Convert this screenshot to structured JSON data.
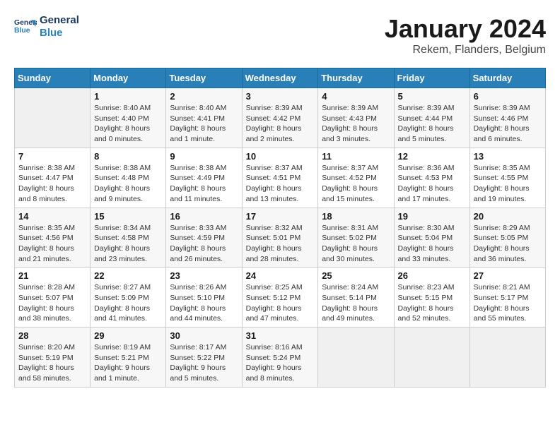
{
  "logo": {
    "text_general": "General",
    "text_blue": "Blue"
  },
  "title": "January 2024",
  "subtitle": "Rekem, Flanders, Belgium",
  "calendar": {
    "headers": [
      "Sunday",
      "Monday",
      "Tuesday",
      "Wednesday",
      "Thursday",
      "Friday",
      "Saturday"
    ],
    "weeks": [
      [
        {
          "day": "",
          "sunrise": "",
          "sunset": "",
          "daylight": ""
        },
        {
          "day": "1",
          "sunrise": "Sunrise: 8:40 AM",
          "sunset": "Sunset: 4:40 PM",
          "daylight": "Daylight: 8 hours and 0 minutes."
        },
        {
          "day": "2",
          "sunrise": "Sunrise: 8:40 AM",
          "sunset": "Sunset: 4:41 PM",
          "daylight": "Daylight: 8 hours and 1 minute."
        },
        {
          "day": "3",
          "sunrise": "Sunrise: 8:39 AM",
          "sunset": "Sunset: 4:42 PM",
          "daylight": "Daylight: 8 hours and 2 minutes."
        },
        {
          "day": "4",
          "sunrise": "Sunrise: 8:39 AM",
          "sunset": "Sunset: 4:43 PM",
          "daylight": "Daylight: 8 hours and 3 minutes."
        },
        {
          "day": "5",
          "sunrise": "Sunrise: 8:39 AM",
          "sunset": "Sunset: 4:44 PM",
          "daylight": "Daylight: 8 hours and 5 minutes."
        },
        {
          "day": "6",
          "sunrise": "Sunrise: 8:39 AM",
          "sunset": "Sunset: 4:46 PM",
          "daylight": "Daylight: 8 hours and 6 minutes."
        }
      ],
      [
        {
          "day": "7",
          "sunrise": "Sunrise: 8:38 AM",
          "sunset": "Sunset: 4:47 PM",
          "daylight": "Daylight: 8 hours and 8 minutes."
        },
        {
          "day": "8",
          "sunrise": "Sunrise: 8:38 AM",
          "sunset": "Sunset: 4:48 PM",
          "daylight": "Daylight: 8 hours and 9 minutes."
        },
        {
          "day": "9",
          "sunrise": "Sunrise: 8:38 AM",
          "sunset": "Sunset: 4:49 PM",
          "daylight": "Daylight: 8 hours and 11 minutes."
        },
        {
          "day": "10",
          "sunrise": "Sunrise: 8:37 AM",
          "sunset": "Sunset: 4:51 PM",
          "daylight": "Daylight: 8 hours and 13 minutes."
        },
        {
          "day": "11",
          "sunrise": "Sunrise: 8:37 AM",
          "sunset": "Sunset: 4:52 PM",
          "daylight": "Daylight: 8 hours and 15 minutes."
        },
        {
          "day": "12",
          "sunrise": "Sunrise: 8:36 AM",
          "sunset": "Sunset: 4:53 PM",
          "daylight": "Daylight: 8 hours and 17 minutes."
        },
        {
          "day": "13",
          "sunrise": "Sunrise: 8:35 AM",
          "sunset": "Sunset: 4:55 PM",
          "daylight": "Daylight: 8 hours and 19 minutes."
        }
      ],
      [
        {
          "day": "14",
          "sunrise": "Sunrise: 8:35 AM",
          "sunset": "Sunset: 4:56 PM",
          "daylight": "Daylight: 8 hours and 21 minutes."
        },
        {
          "day": "15",
          "sunrise": "Sunrise: 8:34 AM",
          "sunset": "Sunset: 4:58 PM",
          "daylight": "Daylight: 8 hours and 23 minutes."
        },
        {
          "day": "16",
          "sunrise": "Sunrise: 8:33 AM",
          "sunset": "Sunset: 4:59 PM",
          "daylight": "Daylight: 8 hours and 26 minutes."
        },
        {
          "day": "17",
          "sunrise": "Sunrise: 8:32 AM",
          "sunset": "Sunset: 5:01 PM",
          "daylight": "Daylight: 8 hours and 28 minutes."
        },
        {
          "day": "18",
          "sunrise": "Sunrise: 8:31 AM",
          "sunset": "Sunset: 5:02 PM",
          "daylight": "Daylight: 8 hours and 30 minutes."
        },
        {
          "day": "19",
          "sunrise": "Sunrise: 8:30 AM",
          "sunset": "Sunset: 5:04 PM",
          "daylight": "Daylight: 8 hours and 33 minutes."
        },
        {
          "day": "20",
          "sunrise": "Sunrise: 8:29 AM",
          "sunset": "Sunset: 5:05 PM",
          "daylight": "Daylight: 8 hours and 36 minutes."
        }
      ],
      [
        {
          "day": "21",
          "sunrise": "Sunrise: 8:28 AM",
          "sunset": "Sunset: 5:07 PM",
          "daylight": "Daylight: 8 hours and 38 minutes."
        },
        {
          "day": "22",
          "sunrise": "Sunrise: 8:27 AM",
          "sunset": "Sunset: 5:09 PM",
          "daylight": "Daylight: 8 hours and 41 minutes."
        },
        {
          "day": "23",
          "sunrise": "Sunrise: 8:26 AM",
          "sunset": "Sunset: 5:10 PM",
          "daylight": "Daylight: 8 hours and 44 minutes."
        },
        {
          "day": "24",
          "sunrise": "Sunrise: 8:25 AM",
          "sunset": "Sunset: 5:12 PM",
          "daylight": "Daylight: 8 hours and 47 minutes."
        },
        {
          "day": "25",
          "sunrise": "Sunrise: 8:24 AM",
          "sunset": "Sunset: 5:14 PM",
          "daylight": "Daylight: 8 hours and 49 minutes."
        },
        {
          "day": "26",
          "sunrise": "Sunrise: 8:23 AM",
          "sunset": "Sunset: 5:15 PM",
          "daylight": "Daylight: 8 hours and 52 minutes."
        },
        {
          "day": "27",
          "sunrise": "Sunrise: 8:21 AM",
          "sunset": "Sunset: 5:17 PM",
          "daylight": "Daylight: 8 hours and 55 minutes."
        }
      ],
      [
        {
          "day": "28",
          "sunrise": "Sunrise: 8:20 AM",
          "sunset": "Sunset: 5:19 PM",
          "daylight": "Daylight: 8 hours and 58 minutes."
        },
        {
          "day": "29",
          "sunrise": "Sunrise: 8:19 AM",
          "sunset": "Sunset: 5:21 PM",
          "daylight": "Daylight: 9 hours and 1 minute."
        },
        {
          "day": "30",
          "sunrise": "Sunrise: 8:17 AM",
          "sunset": "Sunset: 5:22 PM",
          "daylight": "Daylight: 9 hours and 5 minutes."
        },
        {
          "day": "31",
          "sunrise": "Sunrise: 8:16 AM",
          "sunset": "Sunset: 5:24 PM",
          "daylight": "Daylight: 9 hours and 8 minutes."
        },
        {
          "day": "",
          "sunrise": "",
          "sunset": "",
          "daylight": ""
        },
        {
          "day": "",
          "sunrise": "",
          "sunset": "",
          "daylight": ""
        },
        {
          "day": "",
          "sunrise": "",
          "sunset": "",
          "daylight": ""
        }
      ]
    ]
  }
}
